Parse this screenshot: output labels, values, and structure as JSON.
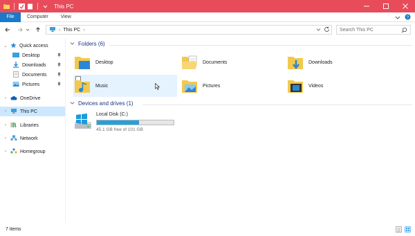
{
  "colors": {
    "accent": "#e84b5a",
    "file_tab": "#1979ca",
    "selected": "#cce8ff",
    "hover": "#e5f3ff",
    "header_text": "#1e3287",
    "drive_fill": "#26a0da"
  },
  "window": {
    "title": "This PC"
  },
  "ribbon": {
    "tabs": [
      "File",
      "Computer",
      "View"
    ]
  },
  "address": {
    "crumbs": [
      "This PC"
    ]
  },
  "search": {
    "placeholder": "Search This PC"
  },
  "navpane": {
    "items": [
      {
        "label": "Quick access",
        "icon": "star-icon"
      },
      {
        "label": "Desktop",
        "icon": "desktop-folder-icon",
        "pinned": true
      },
      {
        "label": "Downloads",
        "icon": "downloads-folder-icon",
        "pinned": true
      },
      {
        "label": "Documents",
        "icon": "documents-folder-icon",
        "pinned": true
      },
      {
        "label": "Pictures",
        "icon": "pictures-folder-icon",
        "pinned": true
      },
      {
        "label": "OneDrive",
        "icon": "cloud-icon"
      },
      {
        "label": "This PC",
        "icon": "computer-icon",
        "selected": true
      },
      {
        "label": "Libraries",
        "icon": "libraries-icon"
      },
      {
        "label": "Network",
        "icon": "network-icon"
      },
      {
        "label": "Homegroup",
        "icon": "homegroup-icon"
      }
    ]
  },
  "content": {
    "folders_header": "Folders (6)",
    "folders": [
      {
        "label": "Desktop",
        "icon": "desktop-folder-icon"
      },
      {
        "label": "Documents",
        "icon": "documents-folder-icon"
      },
      {
        "label": "Downloads",
        "icon": "downloads-folder-icon"
      },
      {
        "label": "Music",
        "icon": "music-folder-icon",
        "hover": true
      },
      {
        "label": "Pictures",
        "icon": "pictures-folder-icon"
      },
      {
        "label": "Videos",
        "icon": "videos-folder-icon"
      }
    ],
    "drives_header": "Devices and drives (1)",
    "drives": [
      {
        "label": "Local Disk (C:)",
        "free_text": "45.1 GB free of 101 GB",
        "used_fraction": 0.553,
        "icon": "drive-icon"
      }
    ]
  },
  "status": {
    "items_text": "7 items"
  }
}
